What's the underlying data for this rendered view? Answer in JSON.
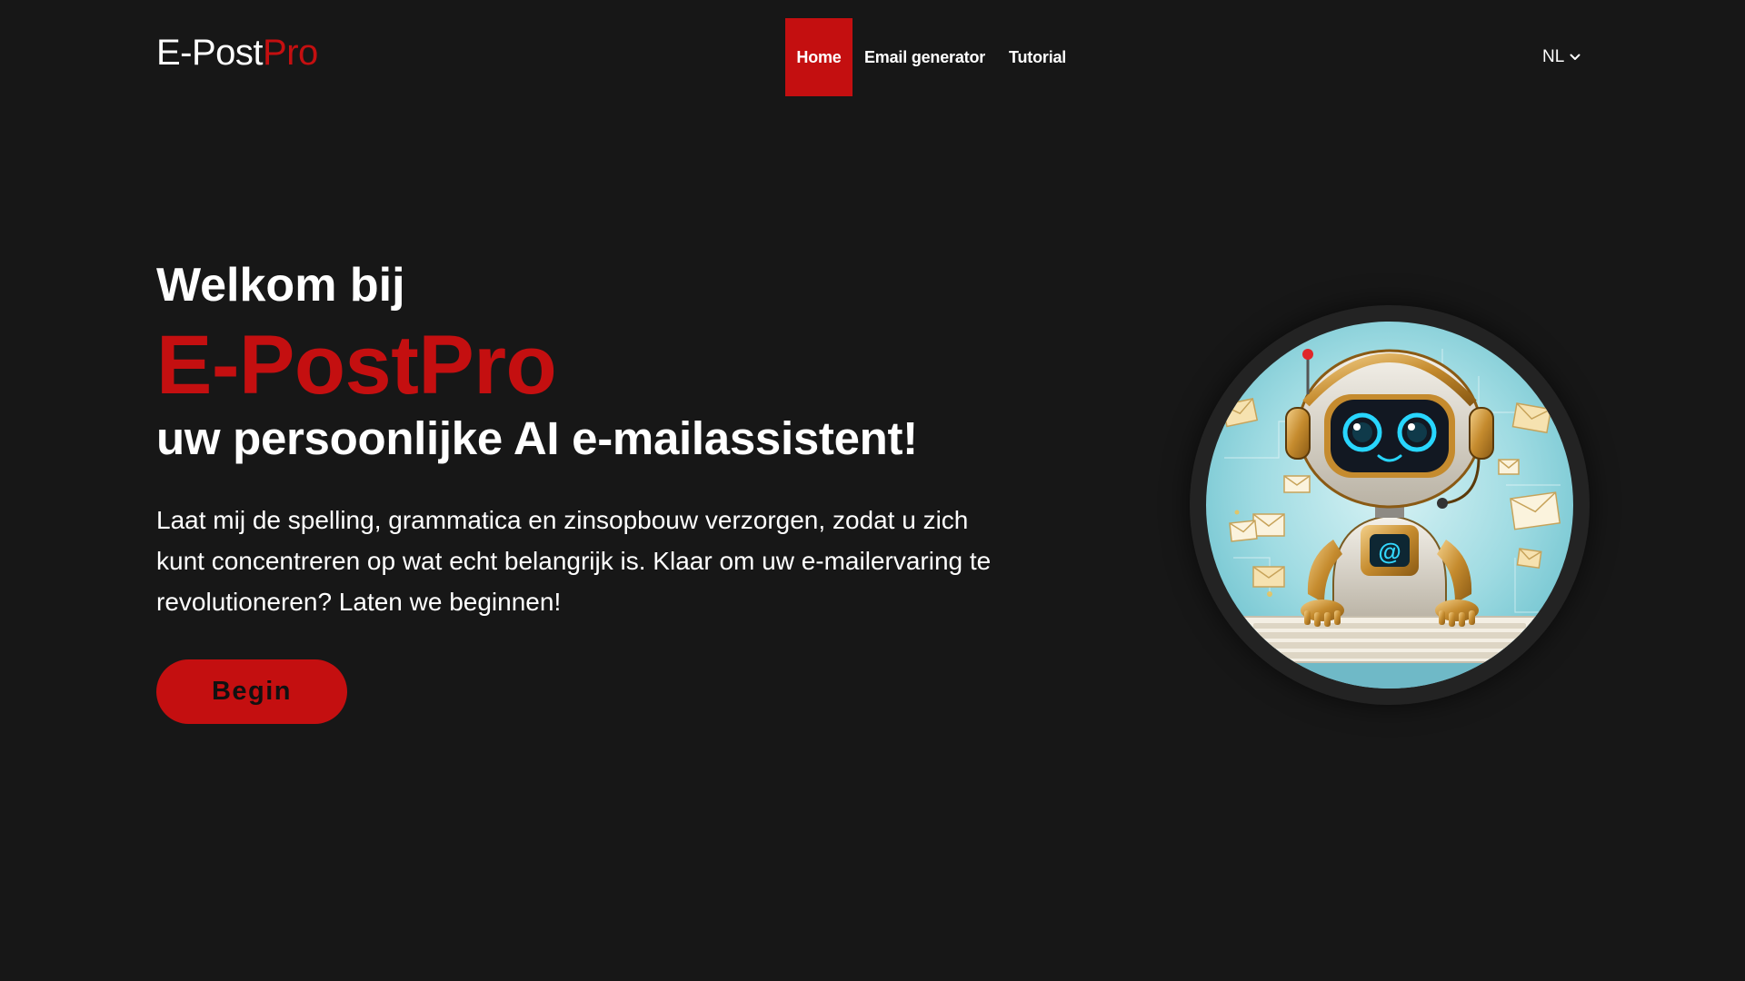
{
  "header": {
    "logo_main": "E-Post",
    "logo_accent": "Pro",
    "nav": [
      {
        "label": "Home",
        "active": true
      },
      {
        "label": "Email generator",
        "active": false
      },
      {
        "label": "Tutorial",
        "active": false
      }
    ],
    "language": "NL",
    "language_icon": "chevron-down-icon"
  },
  "hero": {
    "welcome": "Welkom bij",
    "brand": "E-PostPro",
    "subtitle": "uw persoonlijke AI e-mailassistent!",
    "description": "Laat mij de spelling, grammatica en zinsopbouw verzorgen, zodat u zich kunt concentreren op wat echt belangrijk is. Klaar om uw e-mailervaring te revolutioneren? Laten we beginnen!",
    "button_label": "Begin"
  },
  "image": {
    "subject": "robot-email-assistant-illustration",
    "icon_on_chest": "@"
  },
  "colors": {
    "background": "#171717",
    "accent": "#c40f10",
    "text": "#ffffff",
    "image_ring": "#232323"
  }
}
